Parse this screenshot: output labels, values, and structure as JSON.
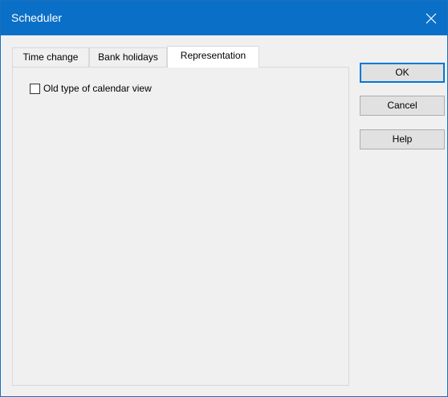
{
  "window": {
    "title": "Scheduler"
  },
  "tabs": [
    {
      "label": "Time change",
      "active": false
    },
    {
      "label": "Bank holidays",
      "active": false
    },
    {
      "label": "Representation",
      "active": true
    }
  ],
  "representation": {
    "old_calendar_view": {
      "label": "Old type of calendar view",
      "checked": false
    }
  },
  "buttons": {
    "ok": "OK",
    "cancel": "Cancel",
    "help": "Help"
  },
  "icons": {
    "close": "close-icon"
  },
  "colors": {
    "titlebar": "#0a6fc7",
    "default_button_border": "#0078d7"
  }
}
